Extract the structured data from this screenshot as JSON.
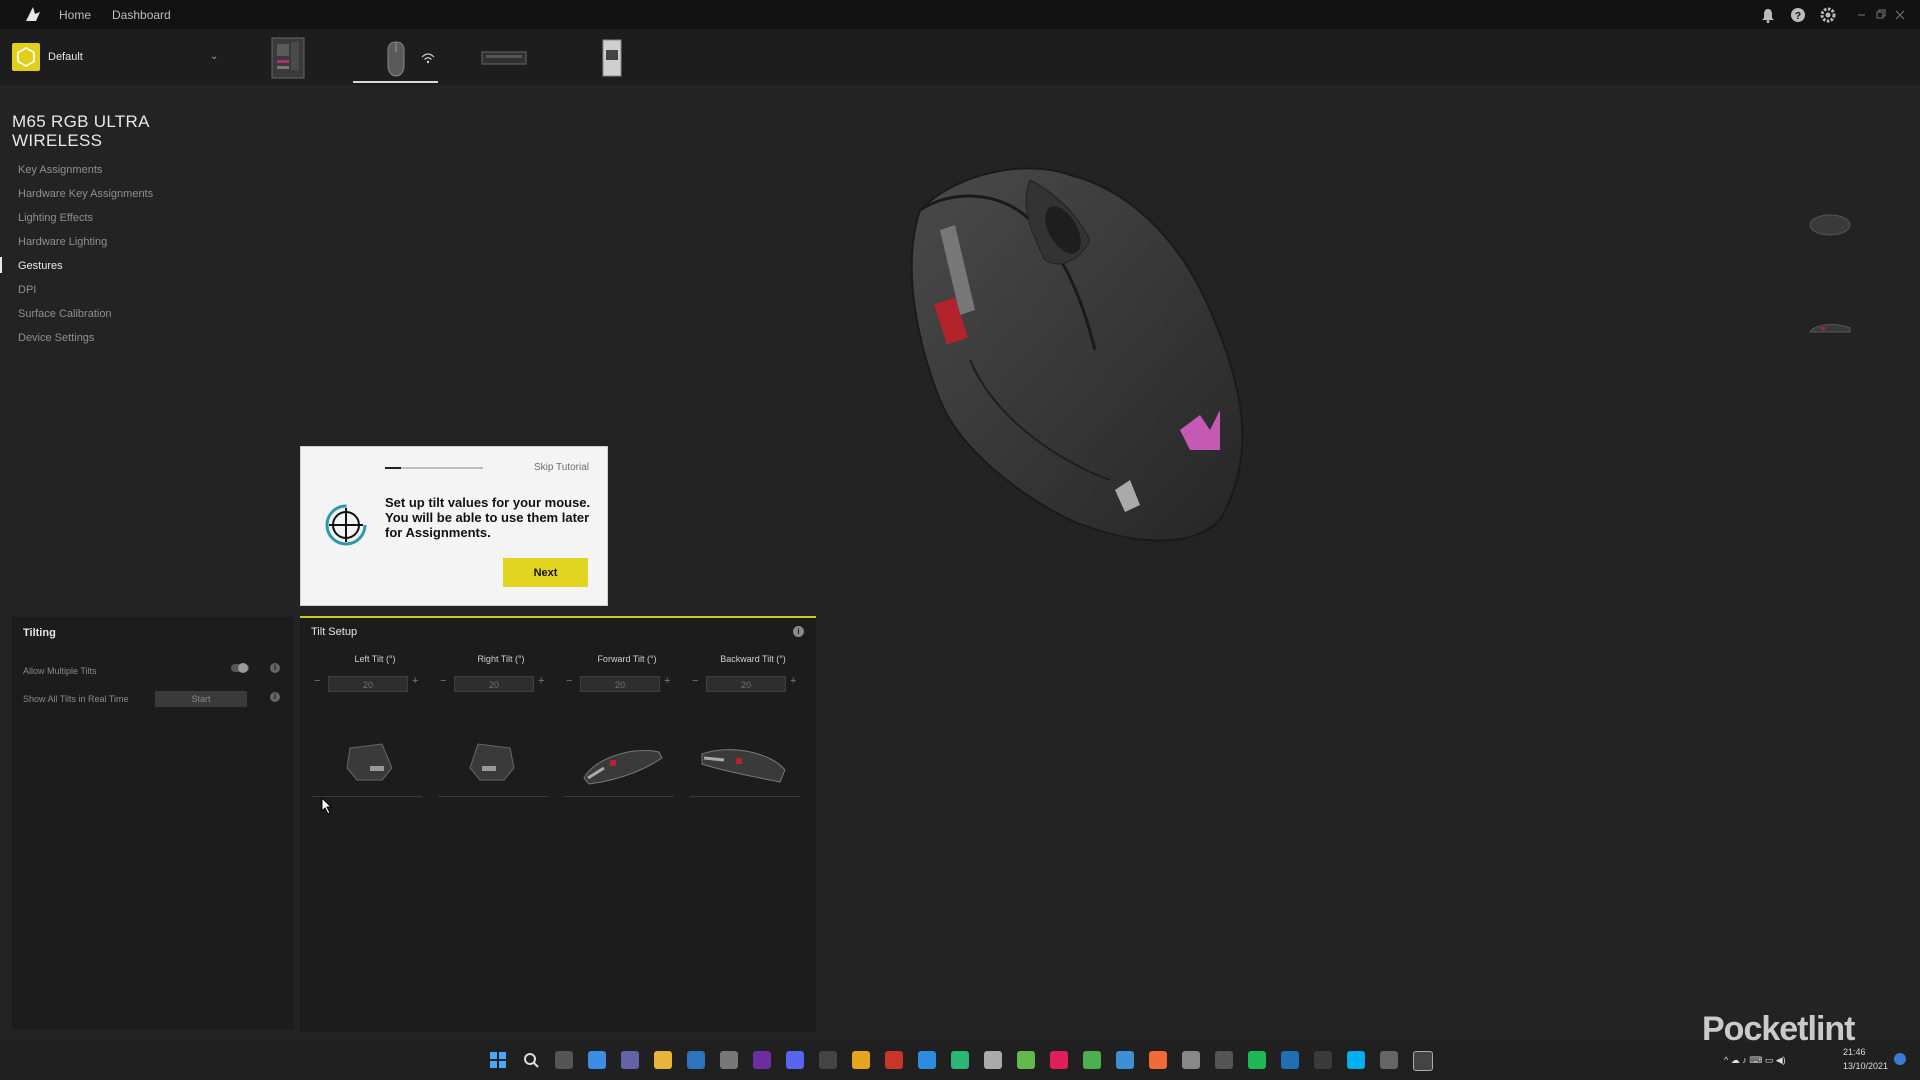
{
  "nav": {
    "home": "Home",
    "dashboard": "Dashboard"
  },
  "profile": {
    "name": "Default"
  },
  "device": {
    "title_line1": "M65 RGB ULTRA",
    "title_line2": "WIRELESS"
  },
  "menu": [
    {
      "label": "Key Assignments",
      "active": false
    },
    {
      "label": "Hardware Key Assignments",
      "active": false
    },
    {
      "label": "Lighting Effects",
      "active": false
    },
    {
      "label": "Hardware Lighting",
      "active": false
    },
    {
      "label": "Gestures",
      "active": true
    },
    {
      "label": "DPI",
      "active": false
    },
    {
      "label": "Surface Calibration",
      "active": false
    },
    {
      "label": "Device Settings",
      "active": false
    }
  ],
  "tutorial": {
    "skip": "Skip Tutorial",
    "text": "Set up tilt values for your mouse. You will be able to use them later for Assignments.",
    "next": "Next",
    "progress": 0.16
  },
  "tilting": {
    "title": "Tilting",
    "allow_multiple": "Allow Multiple Tilts",
    "show_all": "Show All Tilts in Real Time",
    "start": "Start"
  },
  "tilt_setup": {
    "title": "Tilt Setup",
    "columns": [
      {
        "label": "Left Tilt (°)",
        "value": "20"
      },
      {
        "label": "Right Tilt (°)",
        "value": "20"
      },
      {
        "label": "Forward Tilt (°)",
        "value": "20"
      },
      {
        "label": "Backward Tilt (°)",
        "value": "20"
      }
    ]
  },
  "clock": {
    "time": "21:46",
    "date": "13/10/2021"
  },
  "watermark": "Pocketlint",
  "colors": {
    "accent": "#e2d522",
    "background": "#232323"
  }
}
